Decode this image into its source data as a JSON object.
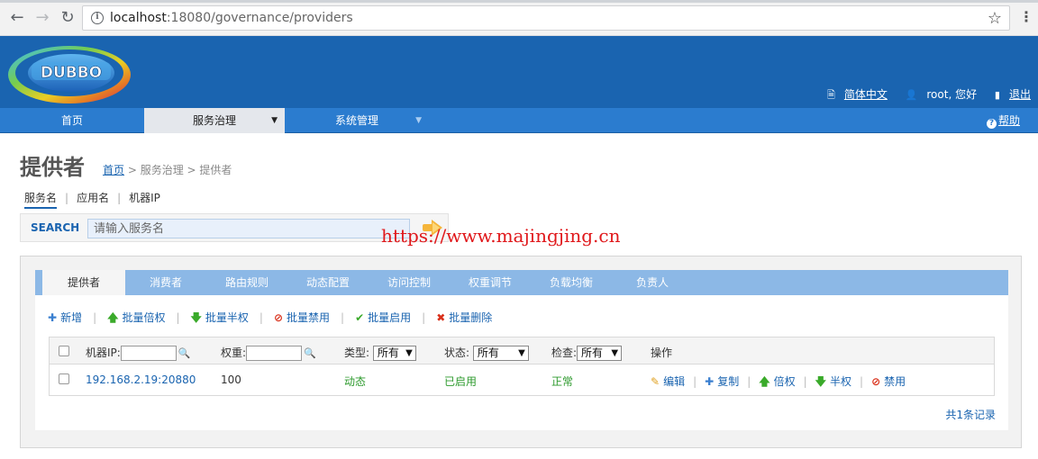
{
  "browser": {
    "url_host": "localhost",
    "url_rest": ":18080/governance/providers",
    "back_icon": "arrow-left-icon",
    "forward_icon": "arrow-right-icon",
    "reload_icon": "reload-icon"
  },
  "header": {
    "logo_text": "DUBBO",
    "lang_link": "简体中文",
    "user_text": "root, 您好",
    "logout_link": "退出"
  },
  "main_nav": {
    "items": [
      {
        "label": "首页"
      },
      {
        "label": "服务治理"
      },
      {
        "label": "系统管理"
      }
    ],
    "help": "帮助"
  },
  "page": {
    "title": "提供者",
    "breadcrumb": {
      "home": "首页",
      "sep1": " > ",
      "level2": "服务治理",
      "sep2": " > ",
      "level3": "提供者"
    }
  },
  "search": {
    "tabs": [
      "服务名",
      "应用名",
      "机器IP"
    ],
    "label": "SEARCH",
    "placeholder": "请输入服务名"
  },
  "watermark": "https://www.majingjing.cn",
  "panel": {
    "tabs": [
      "提供者",
      "消费者",
      "路由规则",
      "动态配置",
      "访问控制",
      "权重调节",
      "负载均衡",
      "负责人"
    ],
    "actions": [
      "新增",
      "批量倍权",
      "批量半权",
      "批量禁用",
      "批量启用",
      "批量删除"
    ],
    "table": {
      "headers": {
        "ip": "机器IP:",
        "weight": "权重:",
        "type": "类型:",
        "type_value": "所有",
        "status": "状态:",
        "status_value": "所有",
        "check": "检查:",
        "check_value": "所有",
        "ops": "操作"
      },
      "rows": [
        {
          "address": "192.168.2.19:20880",
          "weight": "100",
          "type": "动态",
          "status": "已启用",
          "check": "正常",
          "ops": [
            "编辑",
            "复制",
            "倍权",
            "半权",
            "禁用"
          ]
        }
      ]
    },
    "count_text": "共1条记录"
  },
  "colors": {
    "header_bg": "#1a64b0",
    "nav_bg": "#2b7ccf",
    "tabbar_bg": "#8cb8e6",
    "link": "#1a64b0",
    "green": "#2d9a2d",
    "watermark": "#e0181b"
  }
}
